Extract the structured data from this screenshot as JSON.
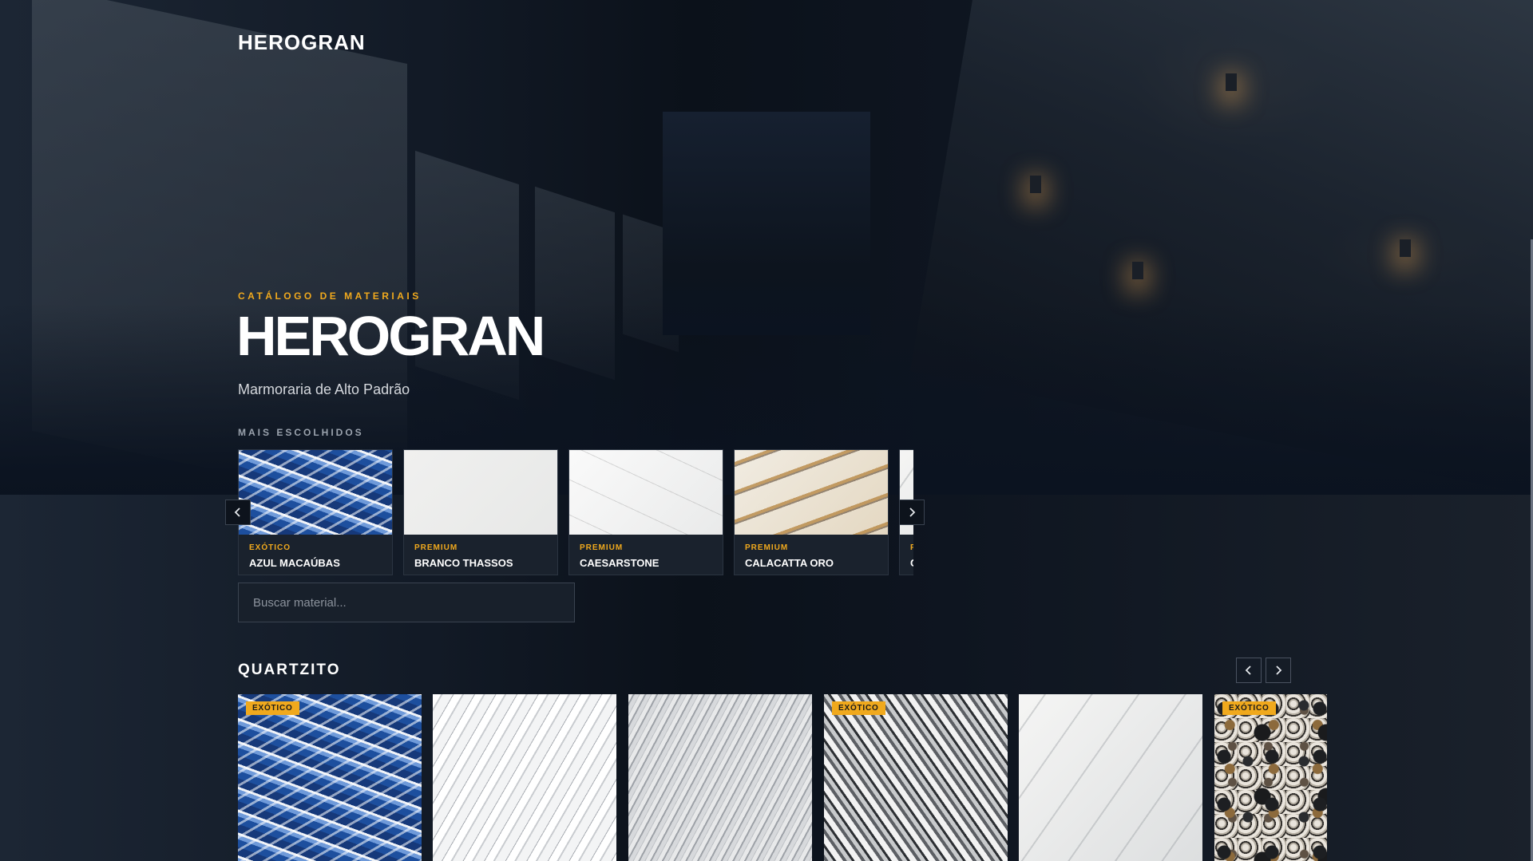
{
  "brand": {
    "logo_text": "HEROGRAN"
  },
  "hero": {
    "eyebrow": "CATÁLOGO DE MATERIAIS",
    "title": "HEROGRAN",
    "subtitle": "Marmoraria de Alto Padrão"
  },
  "featured": {
    "label": "MAIS ESCOLHIDOS",
    "items": [
      {
        "tag": "EXÓTICO",
        "name": "AZUL MACAÚBAS"
      },
      {
        "tag": "PREMIUM",
        "name": "BRANCO THASSOS"
      },
      {
        "tag": "PREMIUM",
        "name": "CAESARSTONE"
      },
      {
        "tag": "PREMIUM",
        "name": "CALACATTA ORO"
      },
      {
        "tag": "P",
        "name": "C"
      }
    ]
  },
  "search": {
    "placeholder": "Buscar material..."
  },
  "categories": [
    {
      "title": "QUARTZITO",
      "tiles": [
        {
          "badge": "EXÓTICO"
        },
        {
          "badge": ""
        },
        {
          "badge": ""
        },
        {
          "badge": "EXÓTICO"
        },
        {
          "badge": ""
        },
        {
          "badge": "EXÓTICO"
        }
      ]
    }
  ],
  "icons": {
    "prev": "chevron-left-icon",
    "next": "chevron-right-icon"
  },
  "colors": {
    "accent": "#f0a91d",
    "background": "#0b1320",
    "card": "#1a222d"
  }
}
